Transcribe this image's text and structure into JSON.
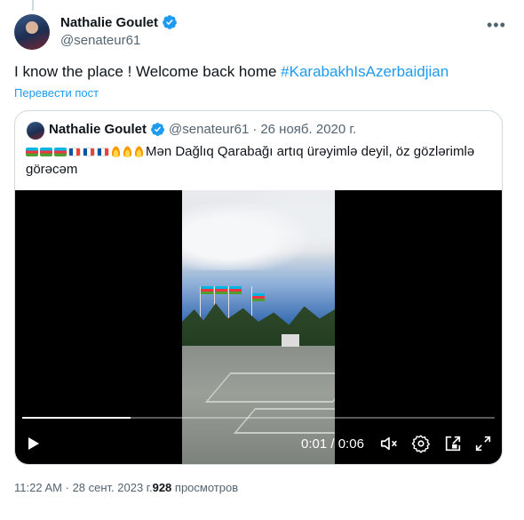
{
  "author": {
    "name": "Nathalie Goulet",
    "handle": "@senateur61",
    "verified_icon": "verified-badge-icon"
  },
  "tweet": {
    "text": "I know the place ! Welcome back home ",
    "hashtag": "#KarabakhIsAzerbaidjian",
    "translate_label": "Перевести пост"
  },
  "quote": {
    "name": "Nathalie Goulet",
    "handle": "@senateur61",
    "separator": "·",
    "date": "26 нояб. 2020 г.",
    "flags": [
      "azerbaijan-flag",
      "azerbaijan-flag",
      "azerbaijan-flag",
      "france-flag",
      "france-flag",
      "france-flag"
    ],
    "fires": [
      "fire-emoji",
      "fire-emoji",
      "fire-emoji"
    ],
    "text": "Mən Dağlıq Qarabağı artıq ürəyimlə deyil, öz gözlərimlə görəcəm"
  },
  "video": {
    "current_time": "0:01",
    "divider": " / ",
    "duration": "0:06",
    "progress_fraction": 0.23
  },
  "footer": {
    "time": "11:22 AM",
    "separator": "·",
    "date": "28 сент. 2023 г.",
    "views_count": "928",
    "views_label": " просмотров"
  },
  "colors": {
    "accent": "#1d9bf0",
    "muted": "#536471",
    "text": "#0f1419"
  }
}
